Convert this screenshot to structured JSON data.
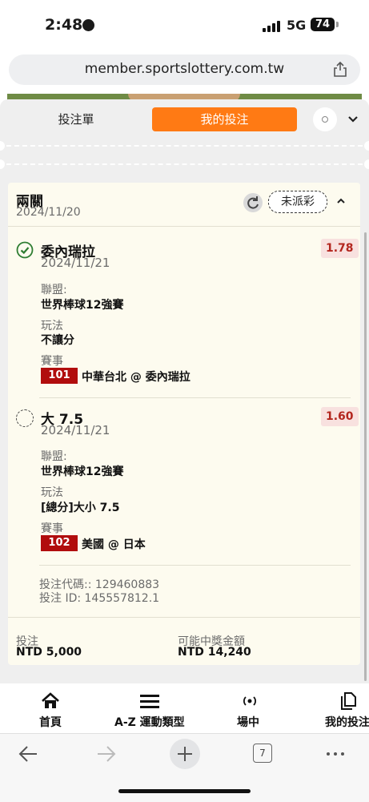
{
  "status_bar": {
    "time": "2:48",
    "network": "5G",
    "battery": "74"
  },
  "browser": {
    "url": "member.sportslottery.com.tw",
    "tab_count": "7"
  },
  "tabs": {
    "bet_slip": "投注單",
    "my_bets": "我的投注"
  },
  "bet": {
    "type": "兩關",
    "date": "2024/11/20",
    "status": "未派彩",
    "selections": [
      {
        "name": "委內瑞拉",
        "date": "2024/11/21",
        "odds": "1.78",
        "league_label": "聯盟:",
        "league": "世界棒球12強賽",
        "play_label": "玩法",
        "play": "不讓分",
        "event_label": "賽事",
        "match_code": "101",
        "match": "中華台北 @ 委內瑞拉",
        "state": "won"
      },
      {
        "name": "大 7.5",
        "date": "2024/11/21",
        "odds": "1.60",
        "league_label": "聯盟:",
        "league": "世界棒球12強賽",
        "play_label": "玩法",
        "play": "[總分]大小 7.5",
        "event_label": "賽事",
        "match_code": "102",
        "match": "美國 @ 日本",
        "state": "pending"
      }
    ],
    "bet_code": "投注代碼:: 129460883",
    "bet_id": "投注 ID: 145557812.1",
    "stake_label": "投注",
    "stake": "NTD 5,000",
    "payout_label": "可能中獎金額",
    "payout": "NTD 14,240"
  },
  "bottom_nav": [
    {
      "label": "首頁",
      "icon": "home-icon"
    },
    {
      "label": "A-Z 運動類型",
      "icon": "menu-icon"
    },
    {
      "label": "場中",
      "icon": "live-icon"
    },
    {
      "label": "我的投注",
      "icon": "my-bets-icon"
    }
  ],
  "colors": {
    "accent": "#ff7a14",
    "odds_text": "#b3261e",
    "match_code_bg": "#b10d0d",
    "card_bg": "#fdfbef"
  }
}
